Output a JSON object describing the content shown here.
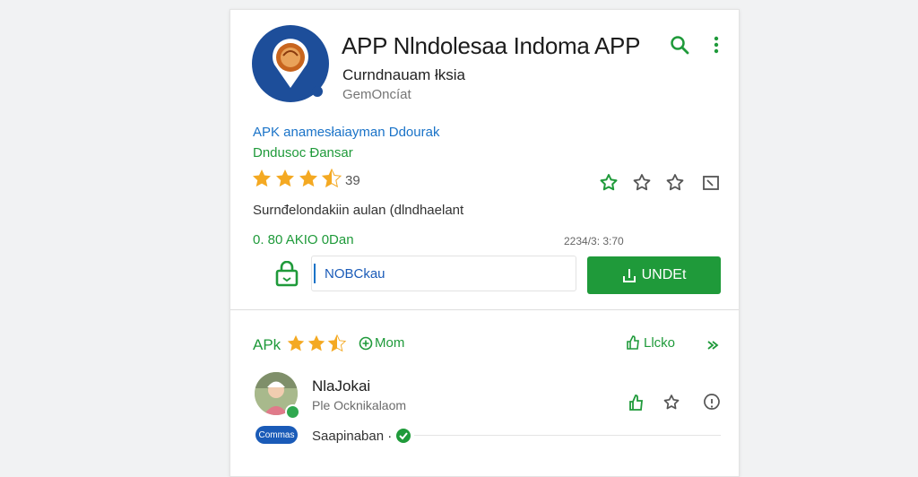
{
  "app": {
    "title": "APP Nlndolesaa Indoma APP",
    "subtitle": "Curndnauam łksia",
    "developer": "GemOncíat"
  },
  "header_actions": {
    "search_icon": "search-icon",
    "more_icon": "more-vert-icon"
  },
  "details": {
    "link_primary": "APK anamesłaiayman Ddourak",
    "link_secondary": "Dndusoc Ðansar",
    "rating_stars": 3.5,
    "rating_count": "39",
    "description": "Surnđelondakiin aulan (dlndhaelant",
    "size_text": "0. 80 AKIO 0Dan",
    "date_text": "2234/3: 3:70"
  },
  "actions": {
    "lock_icon": "lock-icon",
    "search_value": "NOBCkau",
    "install_label": "UNDEt"
  },
  "section": {
    "apk_label": "APk",
    "stars": 2.5,
    "mom_label": "Mom",
    "like_label": "Llcko"
  },
  "review": {
    "name": "NlaJokai",
    "sub": "Ple Ocknikalaom",
    "chip": "Commas",
    "chip_label": "Saapinaban ·"
  },
  "colors": {
    "accent_green": "#1f9a3a",
    "link_blue": "#1a73c8",
    "star_gold": "#f4a922",
    "icon_blue": "#1d4e9a"
  }
}
